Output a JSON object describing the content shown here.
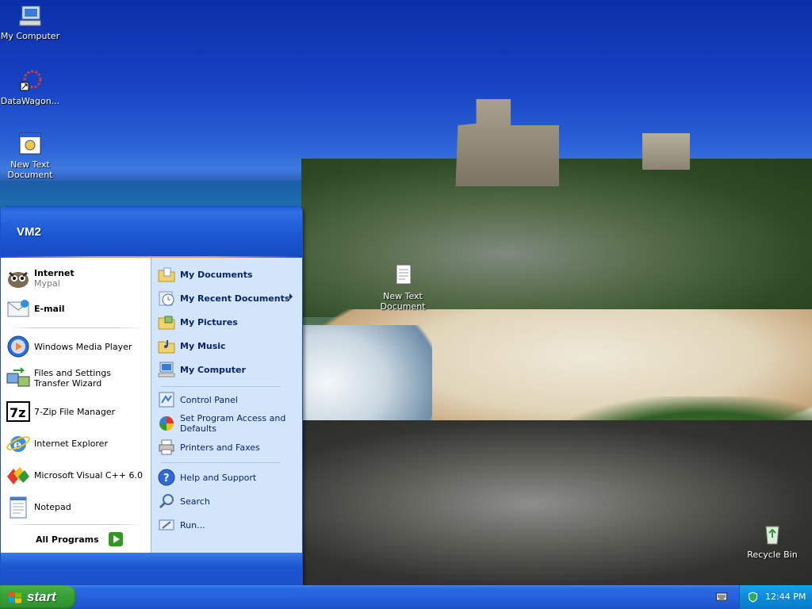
{
  "desktop": {
    "icons": [
      {
        "label": "My Computer",
        "icon": "my-computer-icon"
      },
      {
        "label": "DataWagon...",
        "icon": "datawagon-shortcut-icon"
      },
      {
        "label": "New Text Document",
        "icon": "text-document-icon"
      },
      {
        "label": "New Text Document",
        "icon": "text-document-icon"
      },
      {
        "label": "Recycle Bin",
        "icon": "recycle-bin-icon"
      }
    ]
  },
  "start_menu": {
    "user": "VM2",
    "left": {
      "pinned": [
        {
          "title": "Internet",
          "subtitle": "Mypal",
          "icon": "mypal-browser-icon"
        },
        {
          "title": "E-mail",
          "icon": "email-icon"
        }
      ],
      "recent": [
        {
          "label": "Windows Media Player",
          "icon": "windows-media-player-icon"
        },
        {
          "label": "Files and Settings Transfer Wizard",
          "icon": "transfer-wizard-icon"
        },
        {
          "label": "7-Zip File Manager",
          "icon": "7zip-icon"
        },
        {
          "label": "Internet Explorer",
          "icon": "internet-explorer-icon"
        },
        {
          "label": "Microsoft Visual C++ 6.0",
          "icon": "visual-cpp-icon"
        },
        {
          "label": "Notepad",
          "icon": "notepad-icon"
        }
      ],
      "all_programs": "All Programs"
    },
    "right": {
      "places": [
        {
          "label": "My Documents",
          "icon": "folder-documents-icon"
        },
        {
          "label": "My Recent Documents",
          "icon": "recent-documents-icon"
        },
        {
          "label": "My Pictures",
          "icon": "folder-pictures-icon"
        },
        {
          "label": "My Music",
          "icon": "folder-music-icon"
        },
        {
          "label": "My Computer",
          "icon": "my-computer-icon"
        }
      ],
      "system": [
        {
          "label": "Control Panel",
          "icon": "control-panel-icon"
        },
        {
          "label": "Set Program Access and Defaults",
          "icon": "program-defaults-icon"
        },
        {
          "label": "Printers and Faxes",
          "icon": "printer-icon"
        }
      ],
      "help": [
        {
          "label": "Help and Support",
          "icon": "help-icon"
        },
        {
          "label": "Search",
          "icon": "search-icon"
        },
        {
          "label": "Run...",
          "icon": "run-icon"
        }
      ]
    }
  },
  "taskbar": {
    "start_label": "start",
    "clock": "12:44 PM"
  }
}
